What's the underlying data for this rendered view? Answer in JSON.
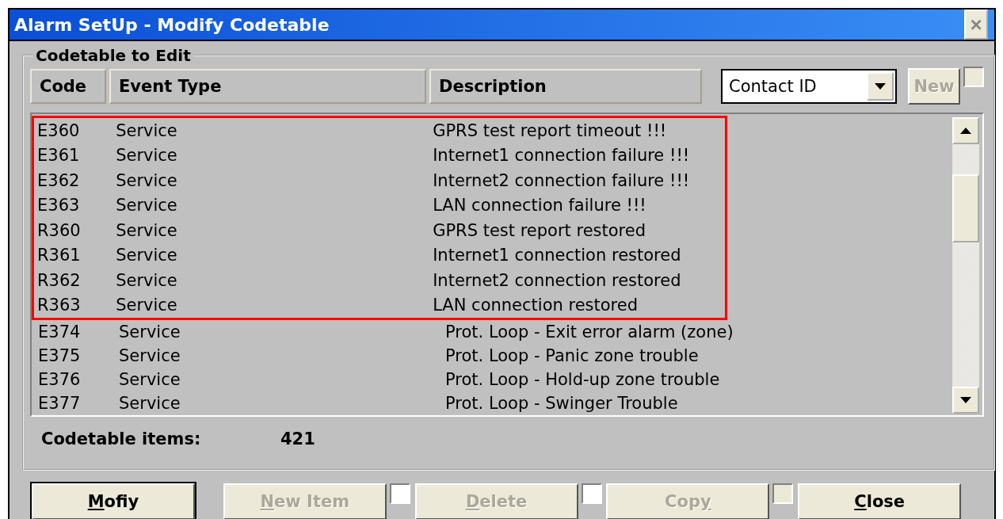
{
  "window": {
    "title": "Alarm SetUp - Modify Codetable",
    "close": "×"
  },
  "group": {
    "title": "Codetable to Edit"
  },
  "columns": [
    "Code",
    "Event Type",
    "Description"
  ],
  "protocol": {
    "value": "Contact ID"
  },
  "new_button": {
    "label": {
      "after": "New"
    },
    "disabled": true
  },
  "new_check": {
    "checked": false,
    "disabled": true
  },
  "rows": [
    {
      "code": "E360",
      "type": "Service",
      "description": "GPRS test report timeout !!!",
      "highlighted": true
    },
    {
      "code": "E361",
      "type": "Service",
      "description": "Internet1 connection failure !!!",
      "highlighted": true
    },
    {
      "code": "E362",
      "type": "Service",
      "description": "Internet2 connection failure !!!",
      "highlighted": true
    },
    {
      "code": "E363",
      "type": "Service",
      "description": "LAN connection failure !!!",
      "highlighted": true
    },
    {
      "code": "R360",
      "type": "Service",
      "description": "GPRS test report restored",
      "highlighted": true
    },
    {
      "code": "R361",
      "type": "Service",
      "description": "Internet1 connection restored",
      "highlighted": true
    },
    {
      "code": "R362",
      "type": "Service",
      "description": "Internet2 connection restored",
      "highlighted": true
    },
    {
      "code": "R363",
      "type": "Service",
      "description": "LAN connection restored",
      "highlighted": true
    },
    {
      "code": "E374",
      "type": "Service",
      "description": "Prot. Loop - Exit error alarm (zone)",
      "highlighted": false
    },
    {
      "code": "E375",
      "type": "Service",
      "description": "Prot. Loop - Panic zone trouble",
      "highlighted": false
    },
    {
      "code": "E376",
      "type": "Service",
      "description": "Prot. Loop - Hold-up zone trouble",
      "highlighted": false
    },
    {
      "code": "E377",
      "type": "Service",
      "description": "Prot. Loop - Swinger Trouble",
      "highlighted": false
    }
  ],
  "summary": {
    "label": "Codetable items:",
    "value": "421"
  },
  "buttons": [
    {
      "label": {
        "key": "M",
        "after": "ofiy"
      },
      "disabled": false,
      "default": true
    },
    {
      "label": {
        "key": "N",
        "after": "ew Item"
      },
      "disabled": true,
      "default": false,
      "check": {
        "checked": false,
        "disabled": false
      }
    },
    {
      "label": {
        "key": "D",
        "after": "elete"
      },
      "disabled": true,
      "default": false,
      "check": {
        "checked": false,
        "disabled": false
      }
    },
    {
      "label": {
        "before": "Cop",
        "key": "y"
      },
      "disabled": true,
      "default": false,
      "check": {
        "checked": false,
        "disabled": true
      }
    },
    {
      "label": {
        "key": "C",
        "after": "lose"
      },
      "disabled": false,
      "default": false
    }
  ]
}
